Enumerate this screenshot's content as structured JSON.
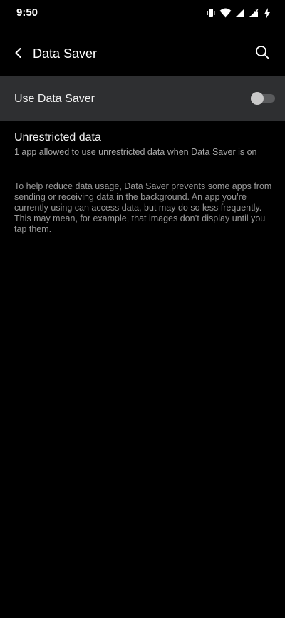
{
  "status_bar": {
    "time": "9:50",
    "icons": [
      "vibrate-icon",
      "wifi-icon",
      "signal-icon",
      "signal-x-icon",
      "charging-icon"
    ]
  },
  "app_bar": {
    "title": "Data Saver",
    "back_icon": "back-arrow-icon",
    "search_icon": "search-icon"
  },
  "data_saver": {
    "label": "Use Data Saver",
    "enabled": false
  },
  "unrestricted": {
    "title": "Unrestricted data",
    "summary": "1 app allowed to use unrestricted data when Data Saver is on"
  },
  "footer": {
    "text": "To help reduce data usage, Data Saver prevents some apps from sending or receiving data in the background. An app you’re currently using can access data, but may do so less frequently. This may mean, for example, that images don’t display until you tap them."
  },
  "colors": {
    "background": "#000000",
    "row_highlight": "#2e2f31",
    "primary_text": "#f1f1f1",
    "secondary_text": "#a6a6a6",
    "toggle_track_off": "#5a5b5d",
    "toggle_thumb_off": "#c9c9c9"
  }
}
